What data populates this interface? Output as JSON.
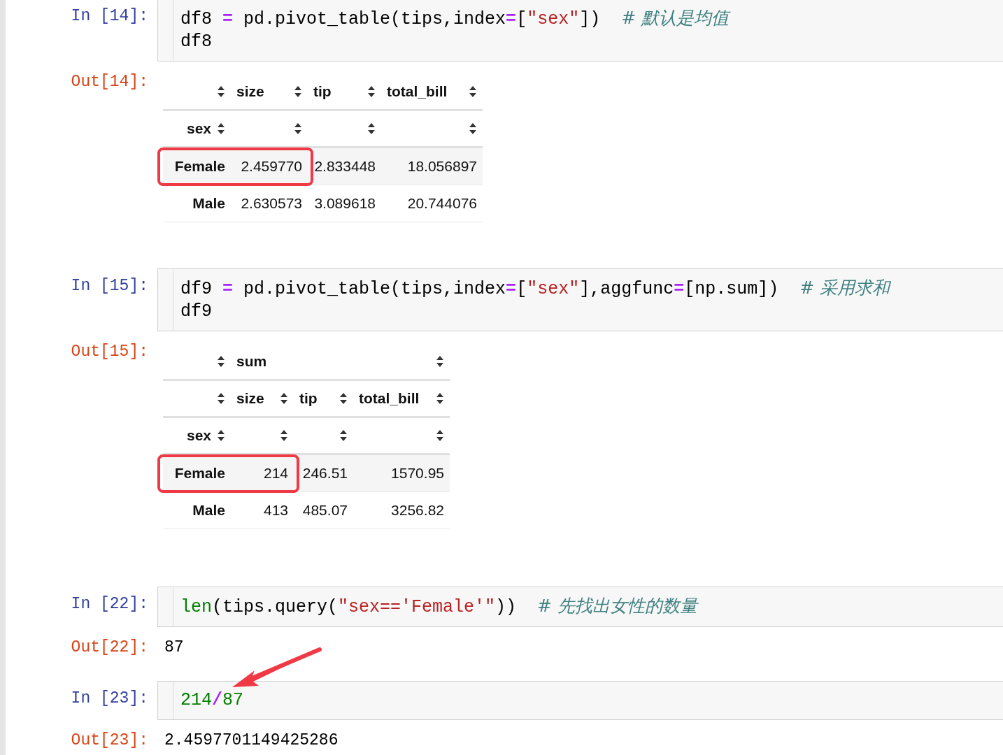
{
  "cells": [
    {
      "input_prompt": "In [14]:",
      "code_lines": [
        [
          {
            "kind": "name",
            "text": "df8 "
          },
          {
            "kind": "op",
            "text": "="
          },
          {
            "kind": "name",
            "text": " pd.pivot_table(tips,index"
          },
          {
            "kind": "op",
            "text": "="
          },
          {
            "kind": "name",
            "text": "["
          },
          {
            "kind": "string",
            "text": "\"sex\""
          },
          {
            "kind": "name",
            "text": "])  "
          },
          {
            "kind": "comment",
            "text": "# 默认是均值"
          }
        ],
        [
          {
            "kind": "name",
            "text": "df8"
          }
        ]
      ],
      "output_prompt": "Out[14]:",
      "output": {
        "kind": "table",
        "columns": [
          "size",
          "tip",
          "total_bill"
        ],
        "index_name": "sex",
        "rows": [
          {
            "index": "Female",
            "values": [
              "2.459770",
              "2.833448",
              "18.056897"
            ],
            "boxed": true
          },
          {
            "index": "Male",
            "values": [
              "2.630573",
              "3.089618",
              "20.744076"
            ],
            "boxed": false
          }
        ]
      }
    },
    {
      "input_prompt": "In [15]:",
      "code_lines": [
        [
          {
            "kind": "name",
            "text": "df9 "
          },
          {
            "kind": "op",
            "text": "="
          },
          {
            "kind": "name",
            "text": " pd.pivot_table(tips,index"
          },
          {
            "kind": "op",
            "text": "="
          },
          {
            "kind": "name",
            "text": "["
          },
          {
            "kind": "string",
            "text": "\"sex\""
          },
          {
            "kind": "name",
            "text": "],aggfunc"
          },
          {
            "kind": "op",
            "text": "="
          },
          {
            "kind": "name",
            "text": "[np.sum])  "
          },
          {
            "kind": "comment",
            "text": "# 采用求和"
          }
        ],
        [
          {
            "kind": "name",
            "text": "df9"
          }
        ]
      ],
      "output_prompt": "Out[15]:",
      "output": {
        "kind": "table",
        "column_group": "sum",
        "columns": [
          "size",
          "tip",
          "total_bill"
        ],
        "index_name": "sex",
        "rows": [
          {
            "index": "Female",
            "values": [
              "214",
              "246.51",
              "1570.95"
            ],
            "boxed": true
          },
          {
            "index": "Male",
            "values": [
              "413",
              "485.07",
              "3256.82"
            ],
            "boxed": false
          }
        ]
      }
    },
    {
      "input_prompt": "In [22]:",
      "code_lines": [
        [
          {
            "kind": "builtin",
            "text": "len"
          },
          {
            "kind": "name",
            "text": "(tips.query("
          },
          {
            "kind": "string",
            "text": "\"sex=='Female'\""
          },
          {
            "kind": "name",
            "text": "))  "
          },
          {
            "kind": "comment",
            "text": "# 先找出女性的数量"
          }
        ]
      ],
      "output_prompt": "Out[22]:",
      "output": {
        "kind": "text",
        "text": "87"
      }
    },
    {
      "input_prompt": "In [23]:",
      "code_lines": [
        [
          {
            "kind": "number",
            "text": "214"
          },
          {
            "kind": "op",
            "text": "/"
          },
          {
            "kind": "number",
            "text": "87"
          }
        ]
      ],
      "output_prompt": "Out[23]:",
      "output": {
        "kind": "text",
        "text": "2.4597701149425286"
      }
    }
  ]
}
